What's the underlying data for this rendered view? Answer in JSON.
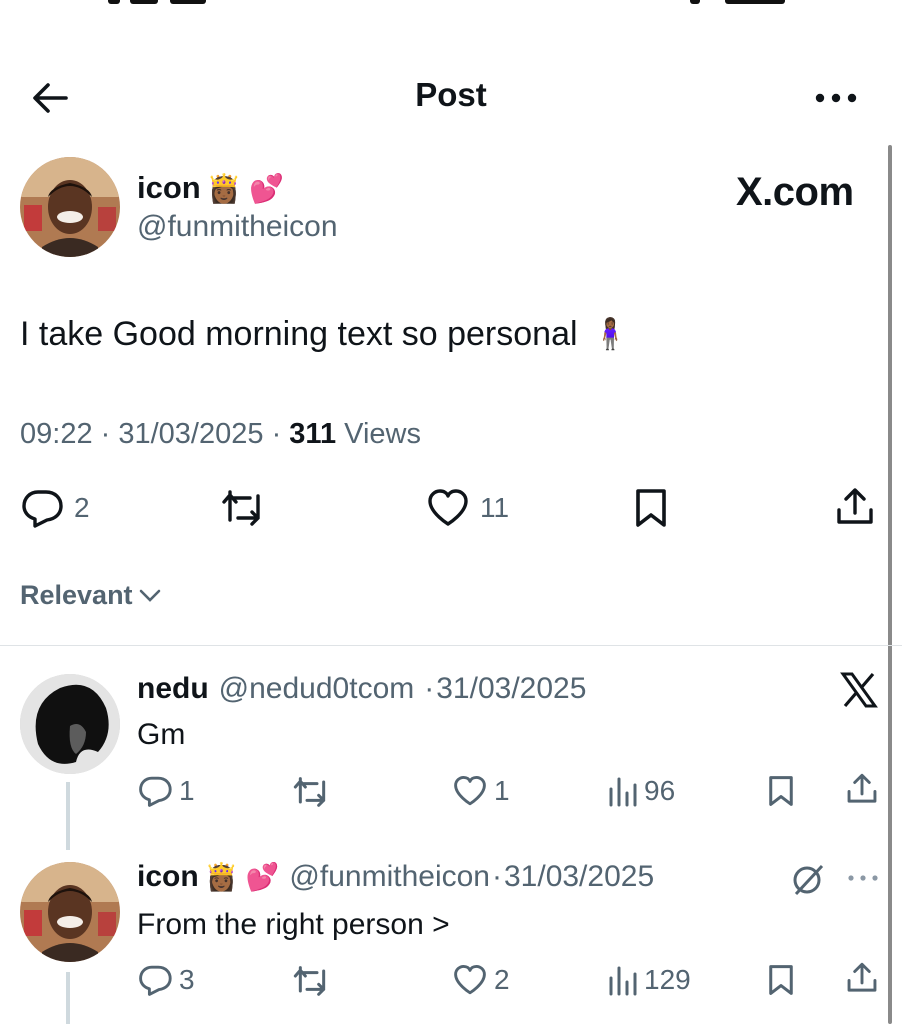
{
  "header": {
    "title": "Post"
  },
  "post": {
    "author_name": "icon",
    "author_emojis": "👸🏾 💕",
    "author_handle": "@funmitheicon",
    "source_label": "X.com",
    "text": "I take Good morning text so personal",
    "text_emoji": "🧍🏾‍♀️",
    "time": "09:22",
    "date": "31/03/2025",
    "views_count": "311",
    "views_label": "Views",
    "replies": "2",
    "likes": "11"
  },
  "sort": {
    "label": "Relevant"
  },
  "replies": [
    {
      "name": "nedu",
      "handle": "@nedud0tcom",
      "date": "31/03/2025",
      "text": "Gm",
      "reply_count": "1",
      "like_count": "1",
      "view_count": "96",
      "badge_icon": "x-logo-icon"
    },
    {
      "name": "icon",
      "emojis": "👸🏾 💕",
      "handle": "@funmitheicon",
      "date": "31/03/2025",
      "text": "From the right person >",
      "reply_count": "3",
      "like_count": "2",
      "view_count": "129",
      "badge_icon": "grok-icon"
    }
  ],
  "colors": {
    "text": "#0f1419",
    "muted": "#536471",
    "divider": "#dfe3e6"
  }
}
